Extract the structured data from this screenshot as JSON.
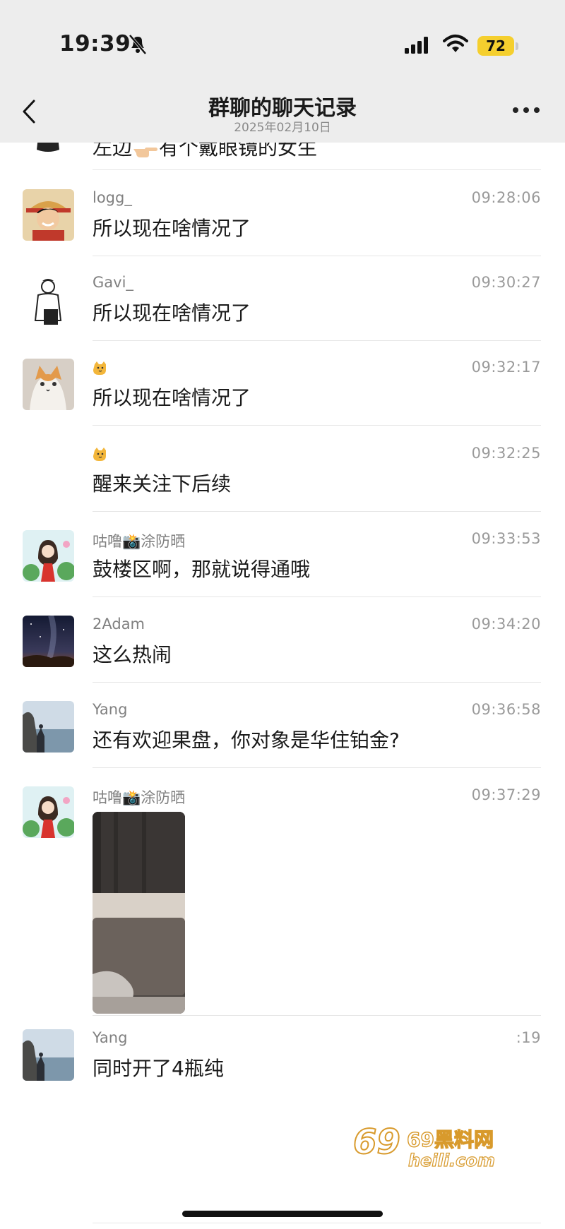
{
  "status_bar": {
    "time": "19:39",
    "battery": "72"
  },
  "header": {
    "title": "群聊的聊天记录",
    "date": "2025年02月10日"
  },
  "partial_message": {
    "text_before": "左边",
    "text_after": "有个戴眼镜的女生"
  },
  "messages": [
    {
      "name": "logg_",
      "time": "09:28:06",
      "text": "所以现在啥情况了",
      "avatar": "luffy-avatar"
    },
    {
      "name": "Gavi_",
      "time": "09:30:27",
      "text": "所以现在啥情况了",
      "avatar": "sketch-man-avatar"
    },
    {
      "name": "",
      "time": "09:32:17",
      "text": "所以现在啥情况了",
      "avatar": "cat-photo-avatar"
    },
    {
      "name": "",
      "time": "09:32:25",
      "text": "醒来关注下后续",
      "avatar": ""
    },
    {
      "name": "咕噜📸涂防晒",
      "time": "09:33:53",
      "text": "鼓楼区啊，那就说得通哦",
      "avatar": "cartoon-girl-avatar"
    },
    {
      "name": "2Adam",
      "time": "09:34:20",
      "text": "这么热闹",
      "avatar": "night-sky-avatar"
    },
    {
      "name": "Yang",
      "time": "09:36:58",
      "text": "还有欢迎果盘，你对象是华住铂金?",
      "avatar": "seaside-avatar"
    },
    {
      "name": "咕噜📸涂防晒",
      "time": "09:37:29",
      "text": "",
      "avatar": "cartoon-girl-avatar"
    },
    {
      "name": "Yang",
      "time": ":19",
      "text": "同时开了4瓶纯",
      "avatar": "seaside-avatar"
    }
  ],
  "watermark": {
    "text": "69黑料网",
    "sub": "heili.com"
  }
}
